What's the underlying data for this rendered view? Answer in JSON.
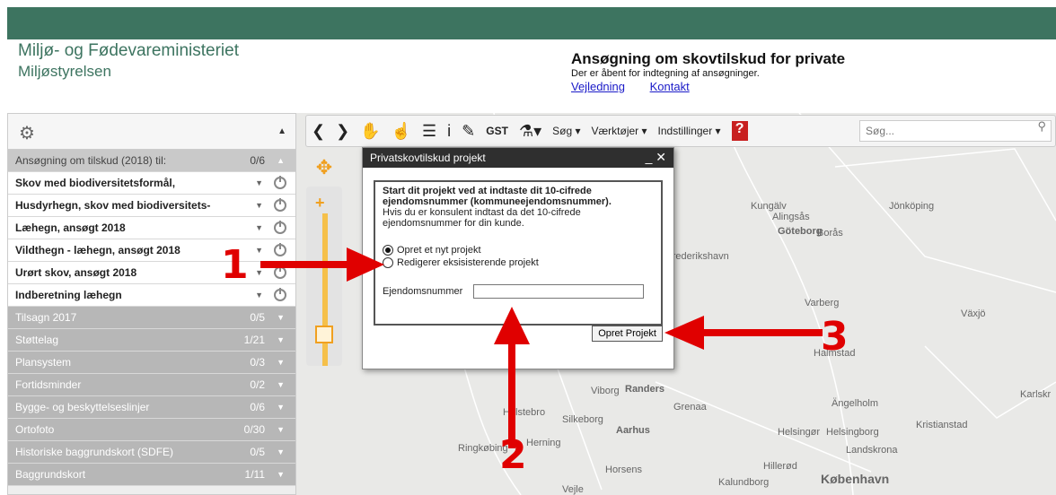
{
  "header": {
    "ministry": "Miljø- og Fødevareministeriet",
    "agency": "Miljøstyrelsen",
    "title": "Ansøgning om skovtilskud for private",
    "subtitle": "Der er åbent for indtegning af ansøgninger.",
    "links": [
      "Vejledning",
      "Kontakt"
    ]
  },
  "toolbar": {
    "gst_label": "GST",
    "menus": [
      "Søg",
      "Værktøjer",
      "Indstillinger"
    ],
    "search_placeholder": "Søg..."
  },
  "sidebar": {
    "application_header": {
      "label": "Ansøgning om tilskud (2018) til:",
      "count": "0/6"
    },
    "layers": [
      "Skov med biodiversitetsformål,",
      "Husdyrhegn, skov med biodiversitets-",
      "Læhegn, ansøgt 2018",
      "Vildthegn - læhegn, ansøgt 2018",
      "Urørt skov, ansøgt 2018",
      "Indberetning læhegn"
    ],
    "groups": [
      {
        "label": "Tilsagn 2017",
        "count": "0/5"
      },
      {
        "label": "Støttelag",
        "count": "1/21"
      },
      {
        "label": "Plansystem",
        "count": "0/3"
      },
      {
        "label": "Fortidsminder",
        "count": "0/2"
      },
      {
        "label": "Bygge- og beskyttelseslinjer",
        "count": "0/6"
      },
      {
        "label": "Ortofoto",
        "count": "0/30"
      },
      {
        "label": "Historiske baggrundskort (SDFE)",
        "count": "0/5"
      },
      {
        "label": "Baggrundskort",
        "count": "1/11"
      }
    ]
  },
  "dialog": {
    "title": "Privatskovtilskud projekt",
    "intro_bold": "Start dit projekt ved at indtaste dit 10-cifrede ejendomsnummer (kommuneejendomsnummer).",
    "intro": "Hvis du er konsulent indtast da det 10-cifrede ejendomsnummer for din kunde.",
    "option_new": "Opret et nyt projekt",
    "option_edit": "Redigerer eksisisterende projekt",
    "field_label": "Ejendomsnummer",
    "button": "Opret Projekt"
  },
  "map_labels": [
    "Alingsås",
    "Kungälv",
    "Borås",
    "Jönköping",
    "Göteborg",
    "Frederikshavn",
    "Varberg",
    "Växjö",
    "Halmstad",
    "Viborg",
    "Randers",
    "Grenaa",
    "Silkeborg",
    "Aarhus",
    "Ringkøbing",
    "Herning",
    "Horsens",
    "Ängelholm",
    "Kristianstad",
    "Helsingør",
    "Helsingborg",
    "Landskrona",
    "Hillerød",
    "København",
    "Kalundborg",
    "Vejle",
    "Holstebro",
    "Karlskr"
  ],
  "annotations": [
    "1",
    "2",
    "3"
  ],
  "colors": {
    "brand": "#3d7460",
    "annotation": "#e00000"
  }
}
